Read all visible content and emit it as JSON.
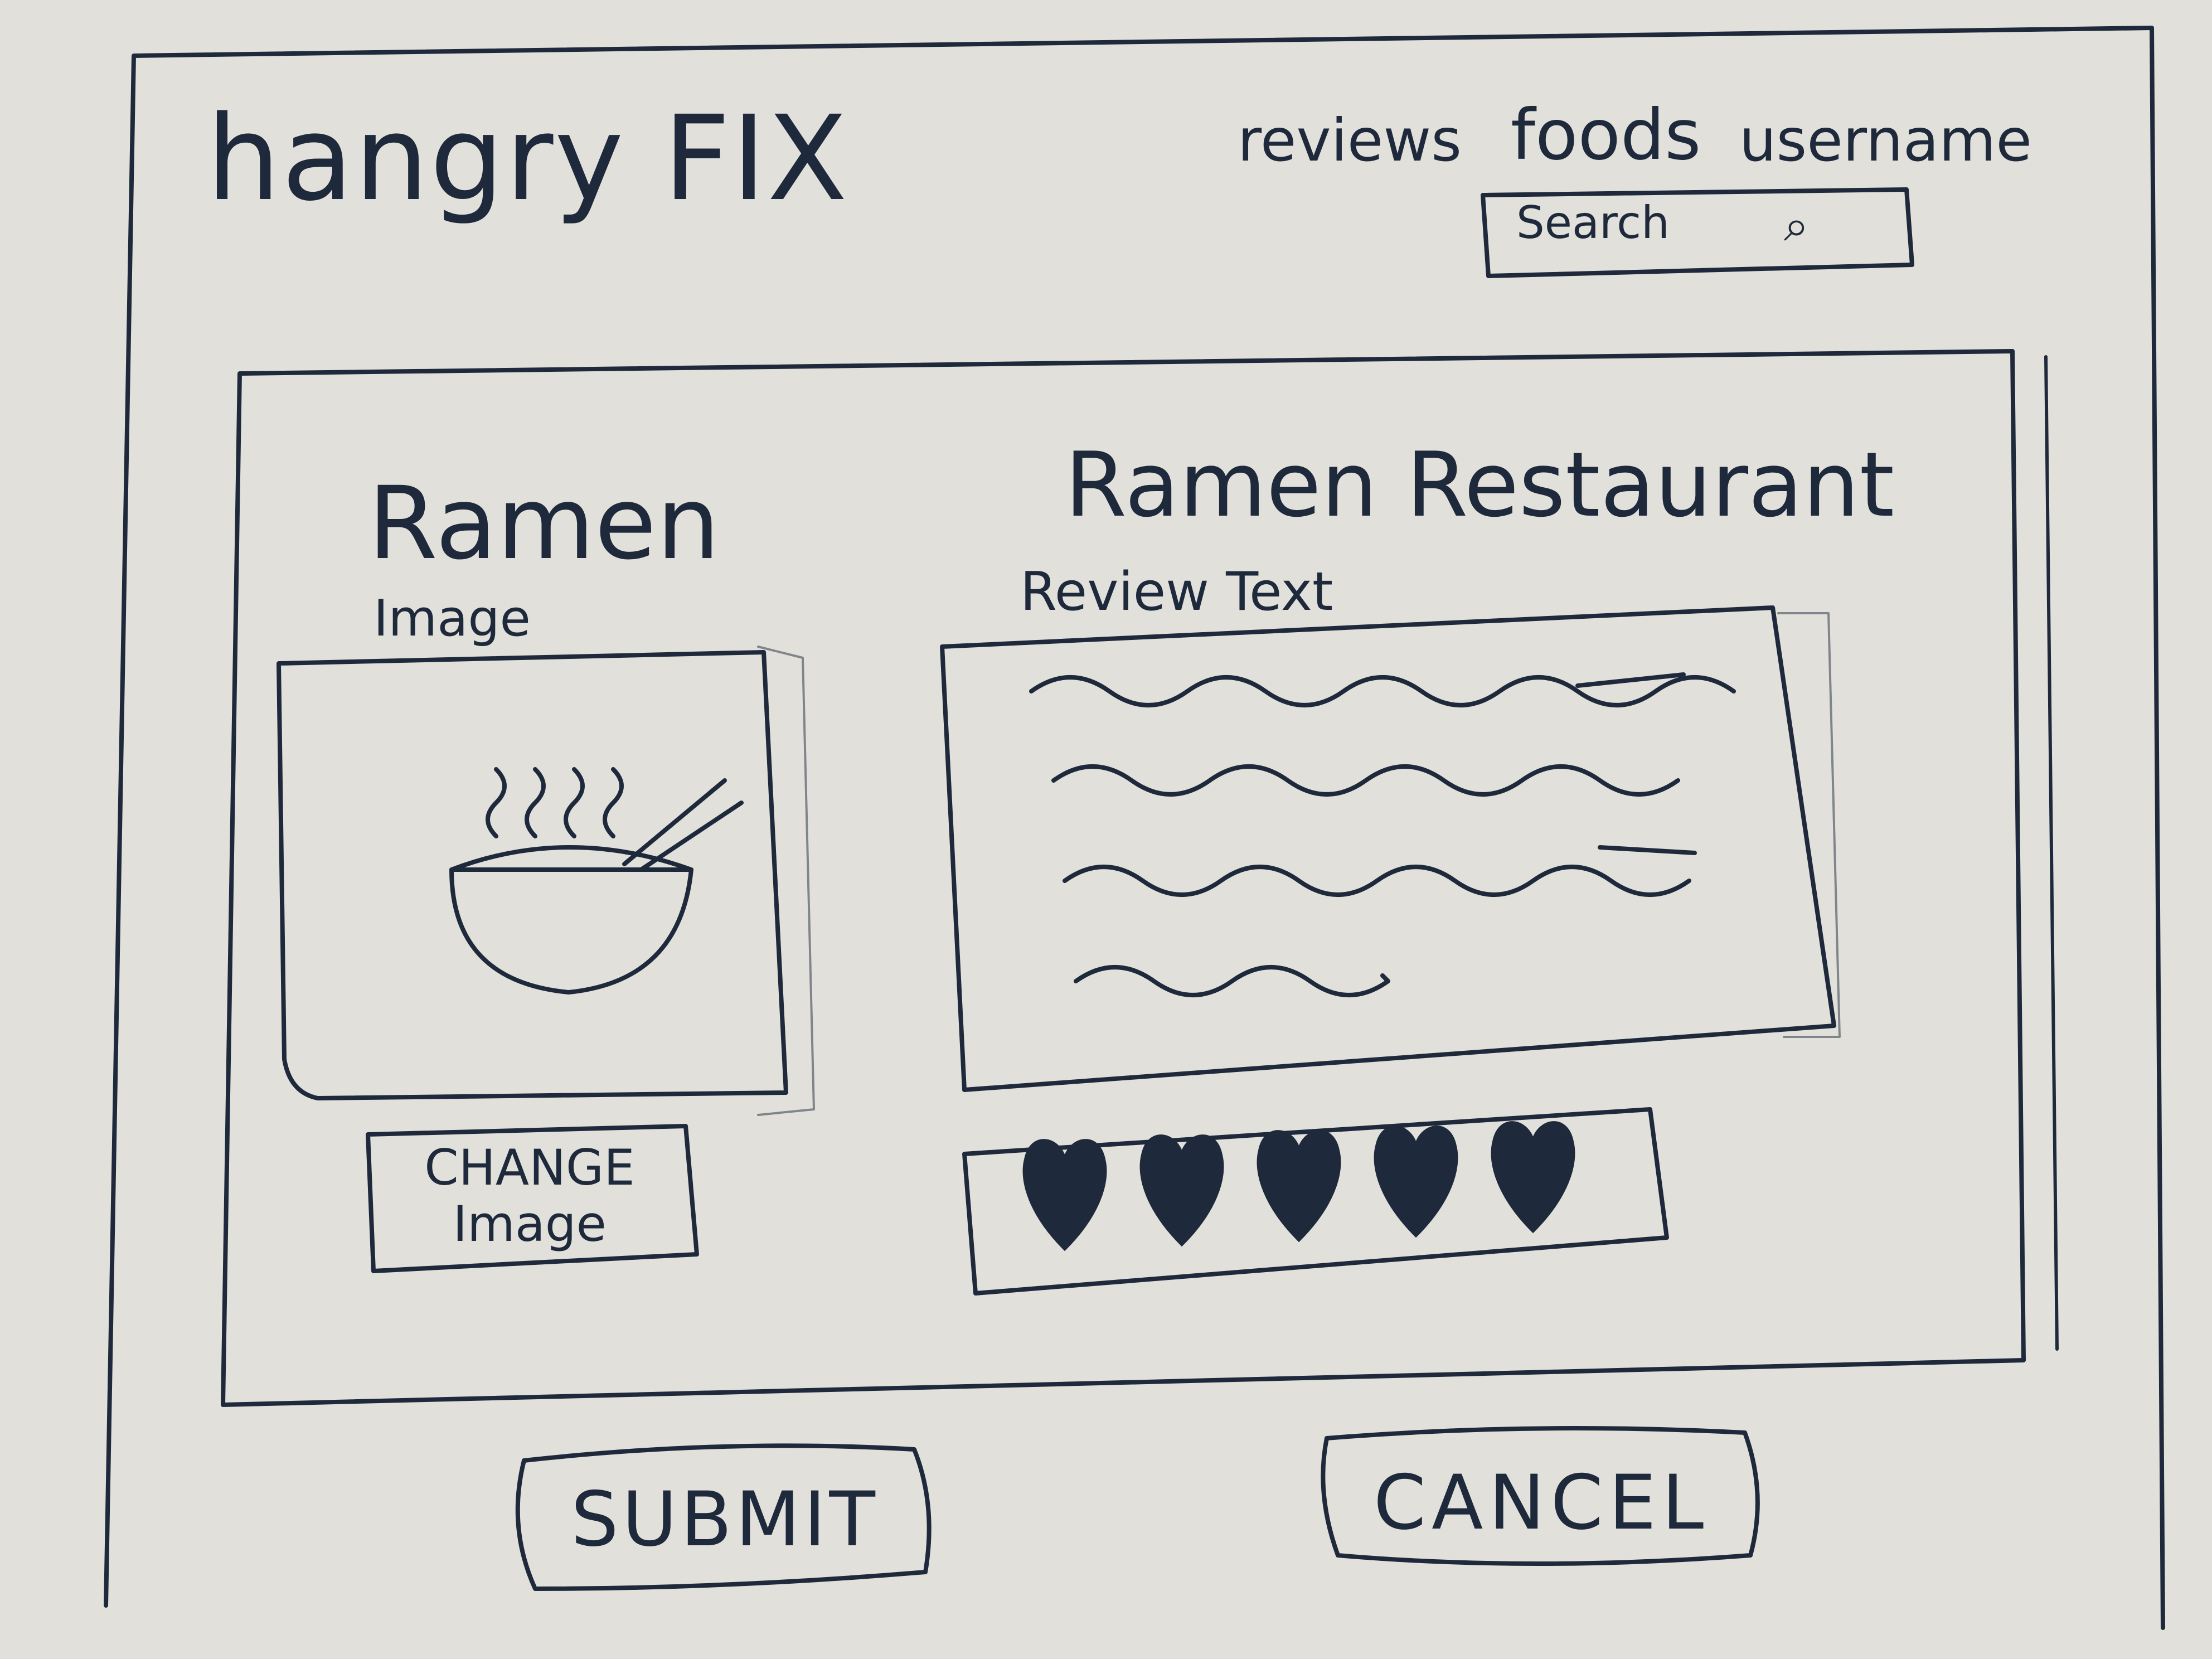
{
  "header": {
    "logo": "hangry FIX",
    "nav": {
      "reviews": "reviews",
      "foods": "foods",
      "username": "username"
    },
    "search": {
      "label": "Search"
    }
  },
  "editor": {
    "food_name": "Ramen",
    "image_label": "Image",
    "change_image_label": "CHANGE\nImage",
    "restaurant_name": "Ramen Restaurant",
    "review_label": "Review Text",
    "rating": {
      "value": 5,
      "max": 5
    }
  },
  "actions": {
    "submit_label": "SUBMIT",
    "cancel_label": "CANCEL"
  },
  "colors": {
    "ink": "#1e2a3c",
    "paper": "#e2e0da"
  }
}
